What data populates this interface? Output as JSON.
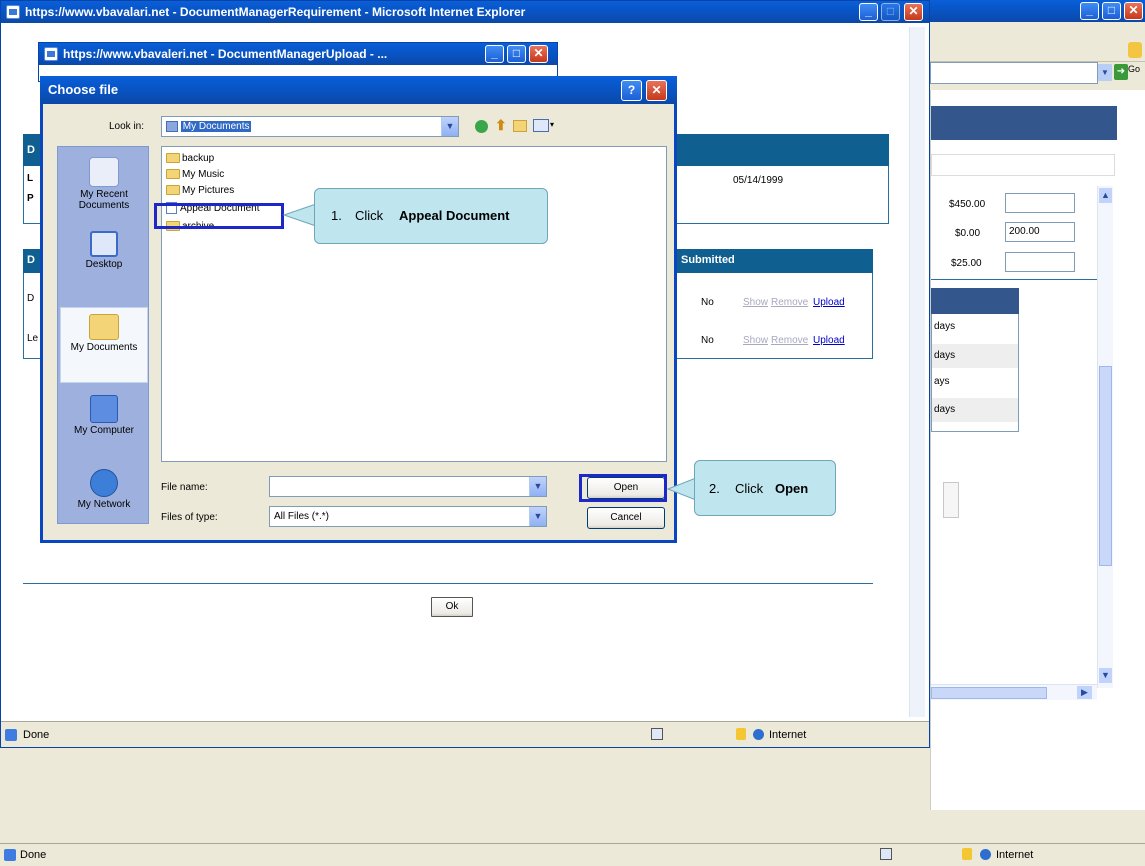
{
  "background_window": {
    "address_go_label": "Go",
    "prices": [
      "$450.00",
      "$0.00",
      "$25.00"
    ],
    "price_inputs": [
      "",
      "200.00",
      ""
    ],
    "days_rows": [
      "days",
      "days",
      "ays",
      "days"
    ],
    "status": {
      "done": "Done",
      "zone": "Internet"
    }
  },
  "ie_window": {
    "title": "https://www.vbavalari.net - DocumentManagerRequirement - Microsoft Internet Explorer",
    "status": {
      "done": "Done",
      "zone": "Internet"
    },
    "page": {
      "section1_row1_label": "L",
      "section1_row2_label": "P",
      "section1_header_letter": "D",
      "date": "05/14/1999",
      "section2_header_letter": "D",
      "row_labels": [
        "D",
        "Le"
      ],
      "submitted_header": "Submitted",
      "rows": [
        {
          "submitted": "No",
          "show": "Show",
          "remove": "Remove",
          "upload": "Upload"
        },
        {
          "submitted": "No",
          "show": "Show",
          "remove": "Remove",
          "upload": "Upload"
        }
      ],
      "ok_button": "Ok"
    }
  },
  "upload_window": {
    "title": "https://www.vbavaleri.net - DocumentManagerUpload - ..."
  },
  "dialog": {
    "title": "Choose file",
    "look_in_label": "Look in:",
    "look_in_value": "My Documents",
    "places": [
      {
        "label": "My Recent Documents",
        "icon": "recent-documents-icon"
      },
      {
        "label": "Desktop",
        "icon": "desktop-icon"
      },
      {
        "label": "My Documents",
        "icon": "my-documents-icon"
      },
      {
        "label": "My Computer",
        "icon": "my-computer-icon"
      },
      {
        "label": "My Network",
        "icon": "my-network-icon"
      }
    ],
    "files": [
      {
        "name": "backup",
        "type": "folder"
      },
      {
        "name": "My Music",
        "type": "folder"
      },
      {
        "name": "My Pictures",
        "type": "folder"
      },
      {
        "name": "Appeal Document",
        "type": "document"
      },
      {
        "name": "archive",
        "type": "folder"
      }
    ],
    "file_name_label": "File name:",
    "file_name_value": "",
    "file_type_label": "Files of type:",
    "file_type_value": "All Files (*.*)",
    "open_button": "Open",
    "cancel_button": "Cancel"
  },
  "callouts": [
    {
      "number": "1.",
      "text": "Click",
      "bold": "Appeal Document"
    },
    {
      "number": "2.",
      "text": "Click",
      "bold": "Open"
    }
  ]
}
